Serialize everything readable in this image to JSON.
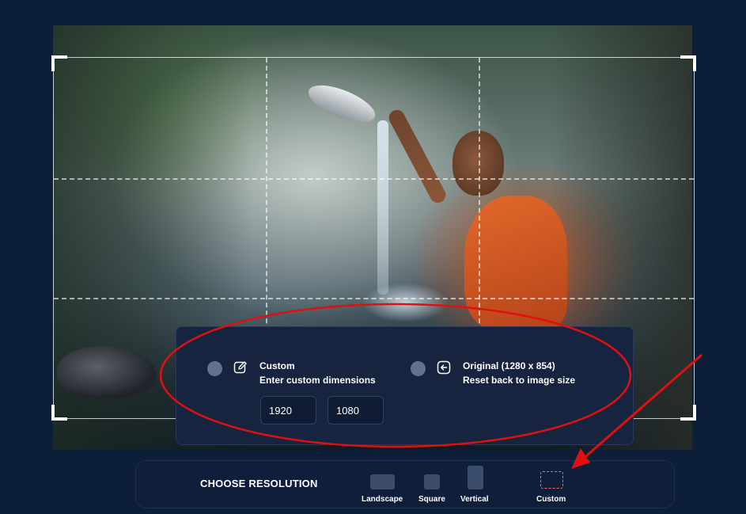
{
  "popup": {
    "custom_option": {
      "title": "Custom",
      "subtitle": "Enter custom dimensions",
      "width_value": "1920",
      "height_value": "1080",
      "icon": "edit-icon"
    },
    "original_option": {
      "title": "Original (1280 x 854)",
      "subtitle": "Reset back to image size",
      "icon": "reset-arrow-icon"
    }
  },
  "resolution_bar": {
    "title": "CHOOSE RESOLUTION",
    "options": [
      {
        "label": "Landscape"
      },
      {
        "label": "Square"
      },
      {
        "label": "Vertical"
      },
      {
        "label": "Custom"
      }
    ]
  },
  "colors": {
    "background": "#0d1e38",
    "panel": "#16243f",
    "annotation": "#e01010",
    "custom_accent": "#ff6a4a"
  }
}
